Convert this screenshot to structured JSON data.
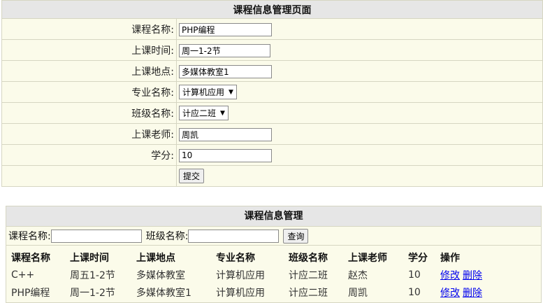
{
  "form": {
    "title": "课程信息管理页面",
    "fields": {
      "course_name": {
        "label": "课程名称:",
        "value": "PHP编程"
      },
      "class_time": {
        "label": "上课时间:",
        "value": "周一1-2节"
      },
      "location": {
        "label": "上课地点:",
        "value": "多媒体教室1"
      },
      "major": {
        "label": "专业名称:",
        "value": "计算机应用"
      },
      "class_name": {
        "label": "班级名称:",
        "value": "计应二班"
      },
      "teacher": {
        "label": "上课老师:",
        "value": "周凯"
      },
      "credit": {
        "label": "学分:",
        "value": "10"
      }
    },
    "submit_label": "提交"
  },
  "list": {
    "title": "课程信息管理",
    "search": {
      "course_label": "课程名称:",
      "course_value": "",
      "class_label": "班级名称:",
      "class_value": "",
      "query_label": "查询"
    },
    "columns": [
      "课程名称",
      "上课时间",
      "上课地点",
      "专业名称",
      "班级名称",
      "上课老师",
      "学分",
      "操作"
    ],
    "rows": [
      {
        "course": "C++",
        "time": "周五1-2节",
        "location": "多媒体教室",
        "major": "计算机应用",
        "class": "计应二班",
        "teacher": "赵杰",
        "credit": "10",
        "edit": "修改",
        "delete": "删除"
      },
      {
        "course": "PHP编程",
        "time": "周一1-2节",
        "location": "多媒体教室1",
        "major": "计算机应用",
        "class": "计应二班",
        "teacher": "周凯",
        "credit": "10",
        "edit": "修改",
        "delete": "删除"
      }
    ]
  },
  "colors": {
    "panel_bg": "#fbfbea",
    "header_bg": "#e6e6e6",
    "border": "#d6d6c2",
    "link": "#0000ee"
  }
}
